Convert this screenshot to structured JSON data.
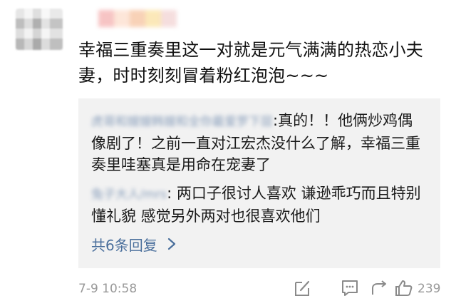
{
  "comment": {
    "text": "幸福三重奏里这一对就是元气满满的热恋小夫妻，时时刻刻冒着粉红泡泡~~~",
    "time": "7-9 10:58",
    "like_count": "239"
  },
  "replies": [
    {
      "user": "虎哥和嫂嫂韩嫂和全你最爱罗下层",
      "text": "真的！！他俩炒鸡偶像剧了！之前一直对江宏杰没什么了解，幸福三重奏里哇塞真是用命在宠妻了"
    },
    {
      "user": "兔子大人/mrs",
      "text": "两口子很讨人喜欢 谦逊乖巧而且特别懂礼貌 感觉另外两对也很喜欢他们"
    }
  ],
  "more_replies_label": "共6条回复",
  "icons": [
    "edit-icon",
    "comment-icon",
    "share-icon",
    "like-icon"
  ],
  "colors": {
    "link": "#4a6f9c",
    "quote_bg": "#f2f2f2",
    "meta": "#999999"
  }
}
